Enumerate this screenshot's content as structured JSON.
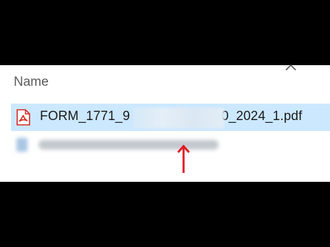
{
  "explorer": {
    "column_header": "Name",
    "file": {
      "name": "FORM_1771_9(redacted)0_2024_1.pdf",
      "name_visible_prefix": "FORM_1771_9",
      "name_visible_suffix": "0_2024_1.pdf",
      "icon": "pdf-file-icon"
    },
    "icons": {
      "sort": "chevron-up-icon",
      "annotation": "red-arrow-up-icon"
    },
    "colors": {
      "selection": "#cce8ff",
      "pdf_red": "#d9251d",
      "arrow_red": "#e01b24"
    }
  }
}
